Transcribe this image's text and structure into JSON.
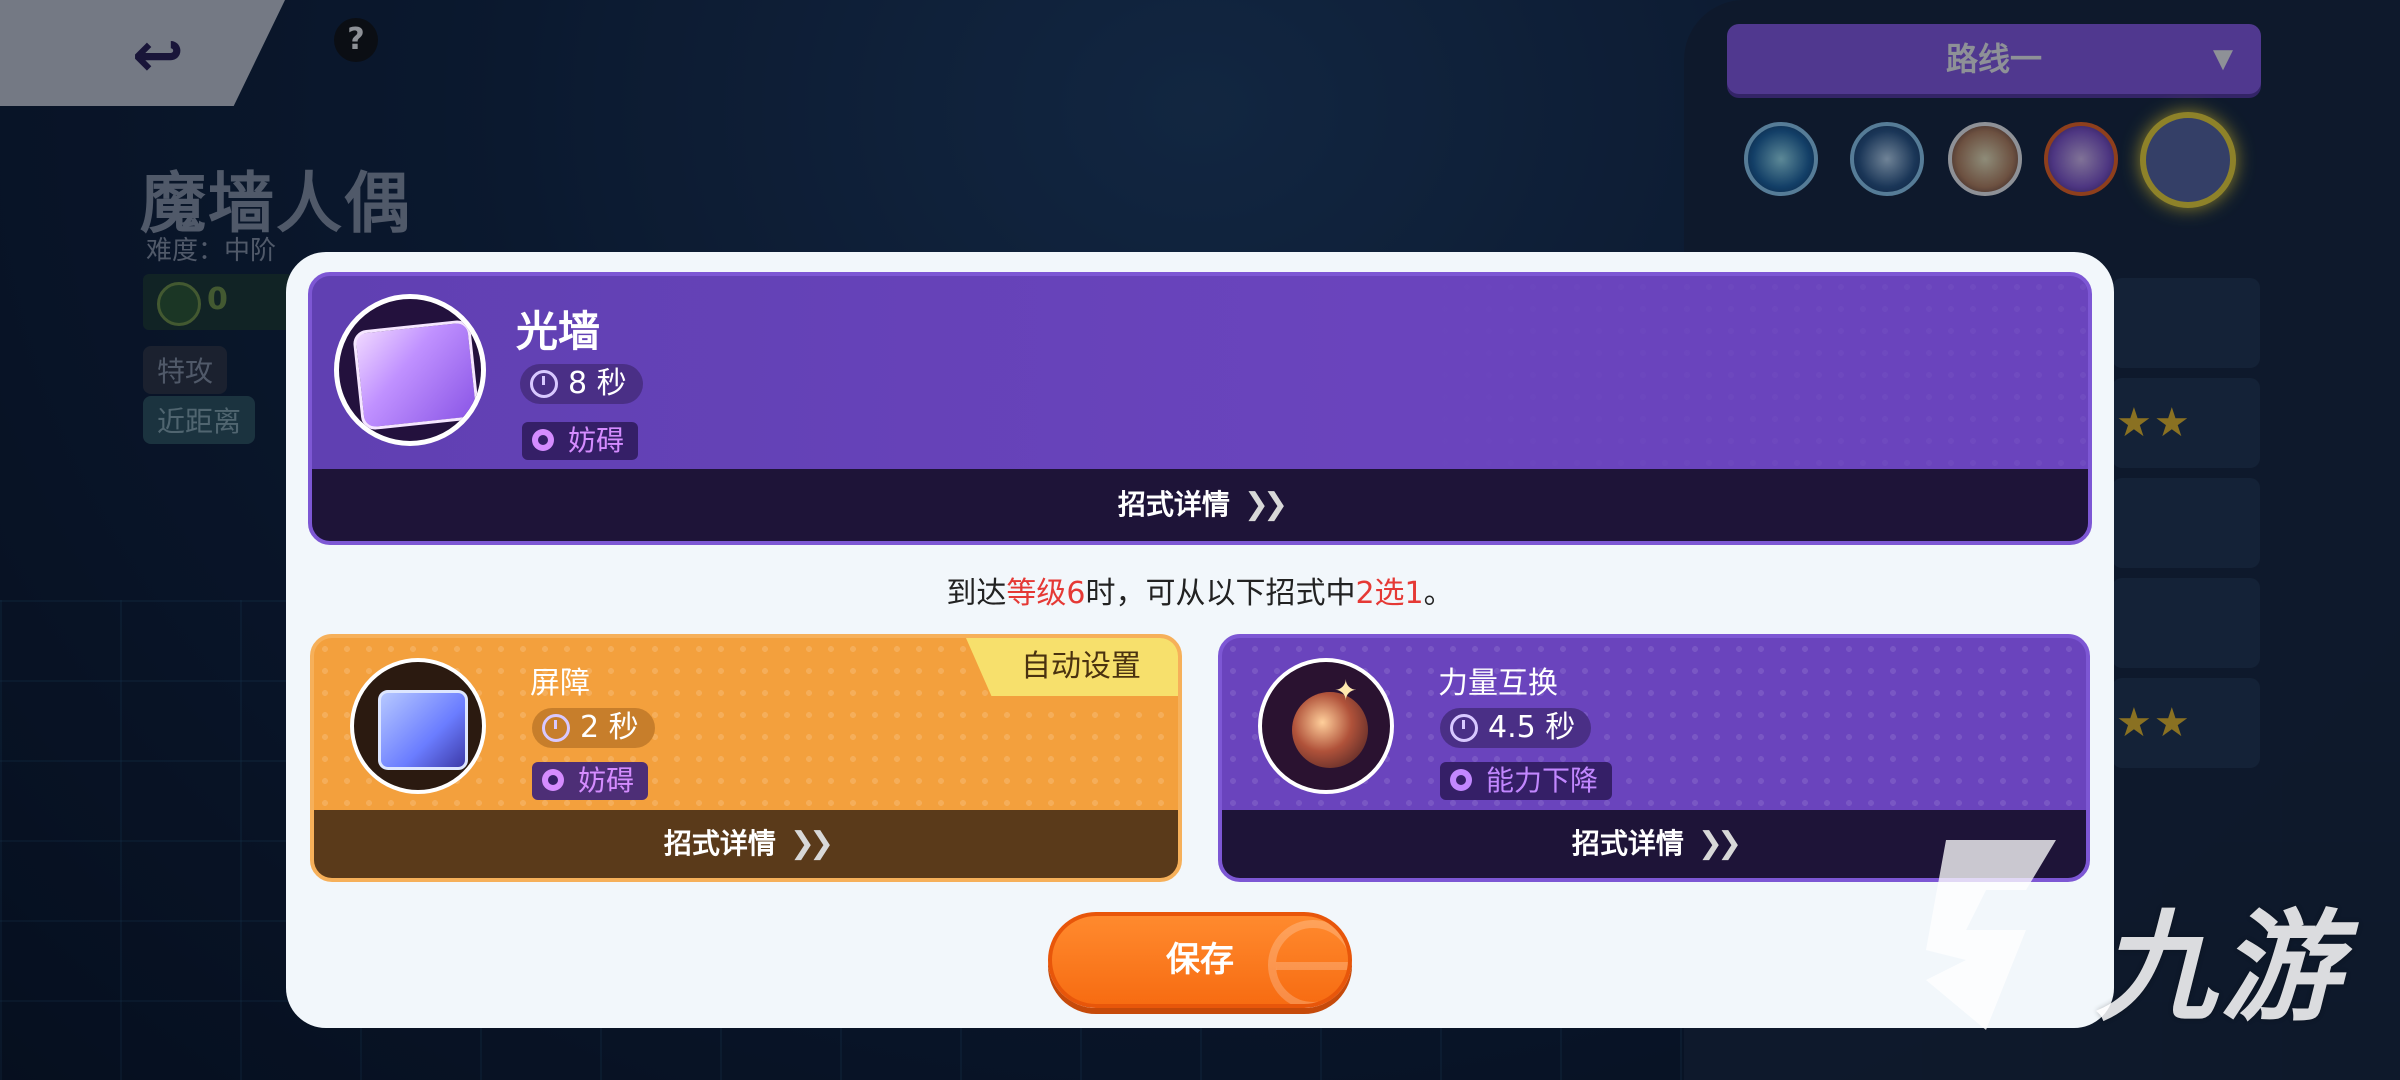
{
  "background": {
    "character_name": "魔墙人偶",
    "difficulty": "难度：中阶",
    "stat_value": "0",
    "tags": [
      "特攻",
      "近距离"
    ]
  },
  "back_button": {
    "icon": "back-arrow-icon"
  },
  "help_button": {
    "label": "?"
  },
  "route_selector": {
    "selected": "路线一"
  },
  "move_icons": [
    "move-1",
    "move-2",
    "move-3",
    "move-4",
    "move-5"
  ],
  "modal": {
    "current_move": {
      "name": "光墙",
      "cooldown": "8 秒",
      "type": "妨碍",
      "details_label": "招式详情"
    },
    "instruction": {
      "prefix": "到达",
      "level_text": "等级6",
      "middle": "时，可从以下招式中",
      "choice_text": "2选1",
      "suffix": "。"
    },
    "options": [
      {
        "name": "屏障",
        "cooldown": "2 秒",
        "type": "妨碍",
        "details_label": "招式详情",
        "badge": "自动设置"
      },
      {
        "name": "力量互换",
        "cooldown": "4.5 秒",
        "type": "能力下降",
        "details_label": "招式详情"
      }
    ],
    "save_label": "保存"
  },
  "watermark": {
    "text": "九游"
  },
  "colors": {
    "purple_card": "#6a44bd",
    "orange_card": "#f3a03d",
    "accent_red": "#e53935",
    "save_orange": "#f76c12",
    "route_purple": "#8f5ef0"
  }
}
